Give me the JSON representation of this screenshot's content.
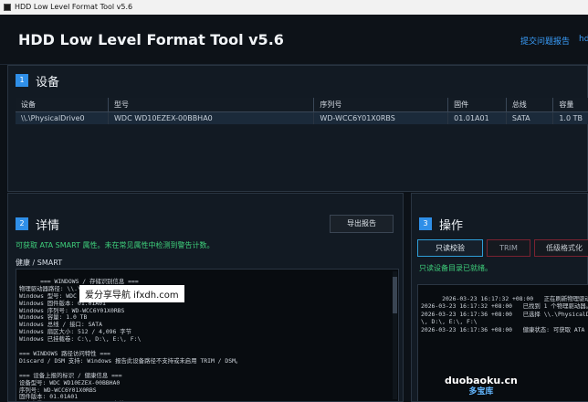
{
  "window": {
    "title": "HDD Low Level Format Tool v5.6"
  },
  "header": {
    "app_title": "HDD Low Level Format Tool v5.6",
    "feedback_link": "提交问题报告",
    "hd_link": "hd"
  },
  "devices_panel": {
    "number": "1",
    "title": "设备",
    "columns": [
      "设备",
      "型号",
      "序列号",
      "固件",
      "总线",
      "容量"
    ],
    "rows": [
      [
        "\\\\.\\PhysicalDrive0",
        "WDC WD10EZEX-00BBHA0",
        "WD-WCC6Y01X0RBS",
        "01.01A01",
        "SATA",
        "1.0 TB"
      ]
    ]
  },
  "details_panel": {
    "number": "2",
    "title": "详情",
    "export_button": "导出报告",
    "smart_note": "可获取 ATA SMART 属性。未在常见属性中检测到警告计数。",
    "health_label": "健康 / SMART",
    "log_text": "=== WINDOWS / 存储识别信息 ===\n物理驱动器路径: \\\\.\\PhysicalDrive0\nWindows 型号: WDC WD10EZEX-00BBHA0\nWindows 固件版本: 01.01A01\nWindows 序列号: WD-WCC6Y01X0RBS\nWindows 容量: 1.0 TB\nWindows 总线 / 接口: SATA\nWindows 扇区大小: 512 / 4,096 字节\nWindows 已挂载卷: C:\\, D:\\, E:\\, F:\\\n\n=== WINDOWS 路径访问特性 ===\nDiscard / DSM 支持: Windows 报告此设备路径不支持或未启用 TRIM / DSM。\n\n=== 设备上报的标识 / 健康信息 ===\n设备型号: WDC WD10EZEX-00BBHA0\n序列号: WD-WCC6Y01X0RBS\n固件版本: 01.01A01\n用户容量: 1,000,204,886,016 字节 [1.0 TB]\n扇区大小: 512 字节 (逻辑), 4,096 字节 (物理)\n转速: 7200 rpm"
  },
  "operations_panel": {
    "number": "3",
    "title": "操作",
    "buttons": [
      "只读校验",
      "TRIM",
      "低级格式化"
    ],
    "status": "只读设备目录已就绪。",
    "log_text": "2026-03-23 16:17:32 +08:00   正在刷新物理驱动器目录...\n2026-03-23 16:17:32 +08:00   已找到 1 个物理驱动器。\n2026-03-23 16:17:36 +08:00   已选择 \\\\.\\PhysicalDrive0\n\\, D:\\, E:\\, F:\\\n2026-03-23 16:17:36 +08:00   健康状态: 可获取 ATA SMART"
  },
  "watermarks": {
    "w1": "爱分享导航 ifxdh.com",
    "w2_main": "duobaoku.cn",
    "w2_sub": "多宝库"
  },
  "colors": {
    "accent": "#2f8fe8",
    "ok_green": "#3fd17c",
    "danger_border": "#7a2230",
    "link": "#3aa0ff"
  }
}
